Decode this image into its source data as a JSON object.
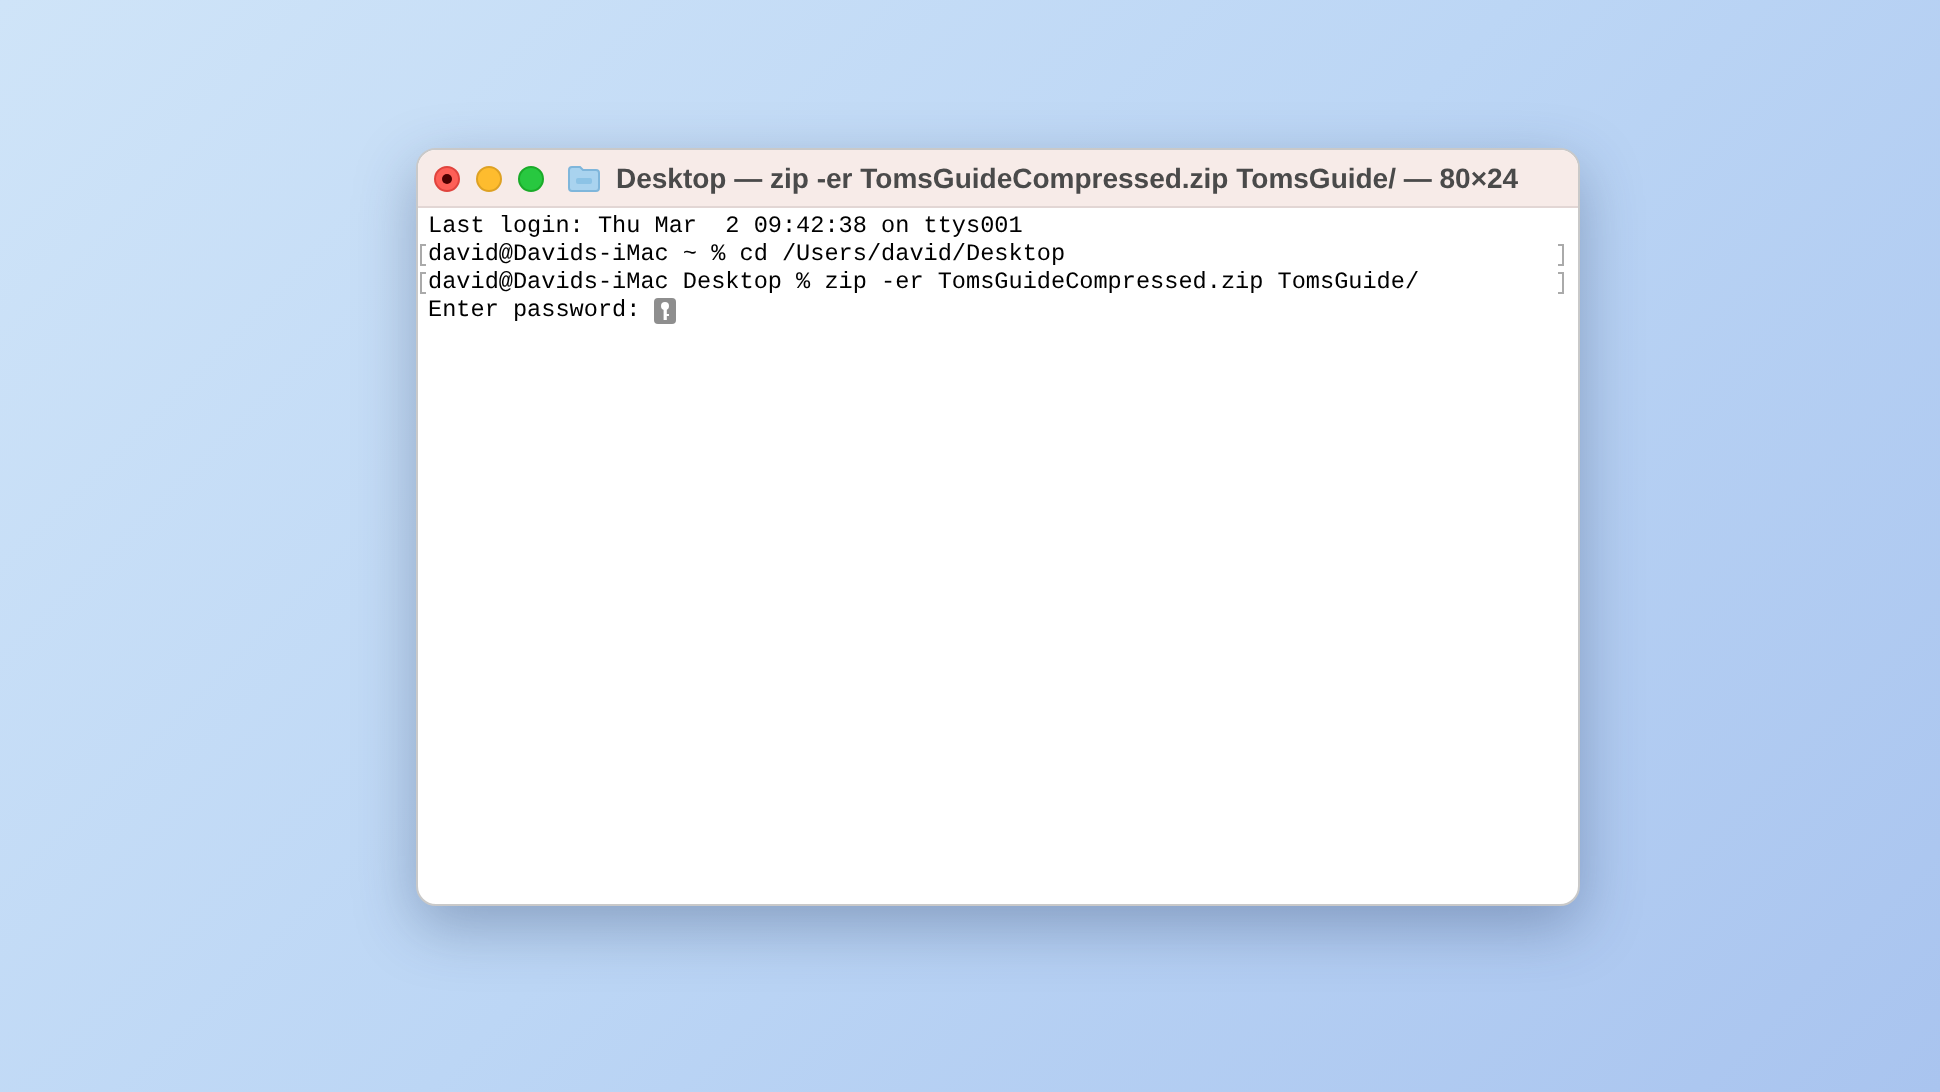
{
  "window": {
    "title": "Desktop — zip -er TomsGuideCompressed.zip TomsGuide/ — 80×24"
  },
  "terminal": {
    "lines": [
      {
        "text": "Last login: Thu Mar  2 09:42:38 on ttys001",
        "marked": false,
        "kind": "output"
      },
      {
        "text": "david@Davids-iMac ~ % cd /Users/david/Desktop",
        "marked": true,
        "kind": "output"
      },
      {
        "text": "david@Davids-iMac Desktop % zip -er TomsGuideCompressed.zip TomsGuide/",
        "marked": true,
        "kind": "output"
      },
      {
        "text": "Enter password:",
        "marked": false,
        "kind": "password_prompt"
      }
    ]
  }
}
